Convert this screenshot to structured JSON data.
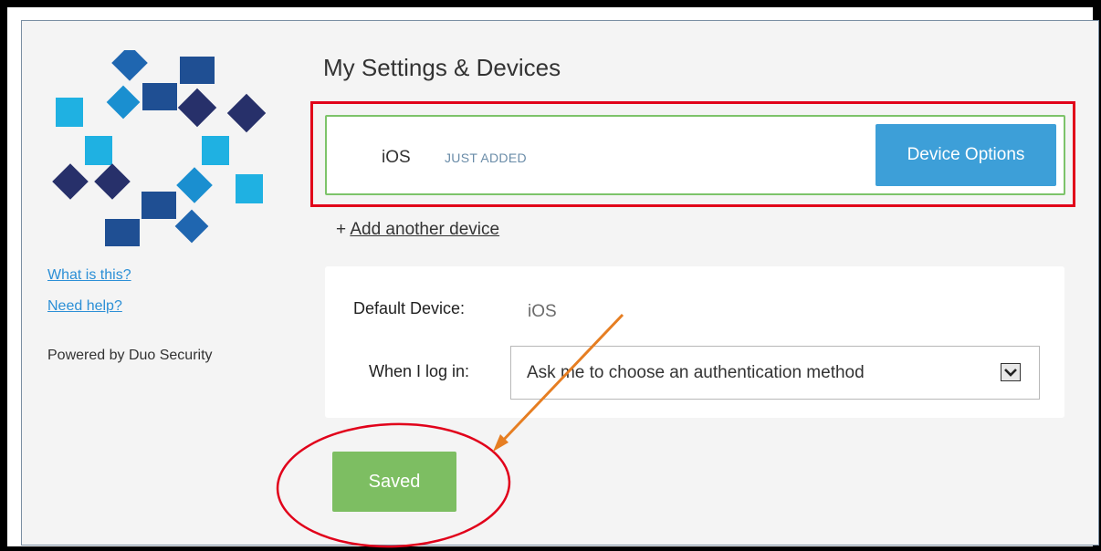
{
  "page": {
    "title": "My Settings & Devices",
    "colors": {
      "panel_border": "#7a8fa3",
      "device_border": "#7dc36a",
      "device_options_button": "#3d9fd8",
      "saved_button": "#7dbe62",
      "annotation_red": "#e1001a",
      "annotation_arrow": "#e67e22"
    }
  },
  "sidebar": {
    "logo_icon": "duo-security-logo",
    "what_is_this": "What is this?",
    "need_help": "Need help?",
    "powered_by": "Powered by Duo Security"
  },
  "device": {
    "name": "iOS",
    "status": "JUST ADDED",
    "options_label": "Device Options"
  },
  "add_device": {
    "prefix": "+",
    "label": "Add another device"
  },
  "settings": {
    "default_device_label": "Default Device:",
    "default_device_value": "iOS",
    "login_label": "When I log in:",
    "login_selected": "Ask me to choose an authentication method",
    "dropdown_icon": "chevron-down-icon"
  },
  "save": {
    "label": "Saved"
  }
}
